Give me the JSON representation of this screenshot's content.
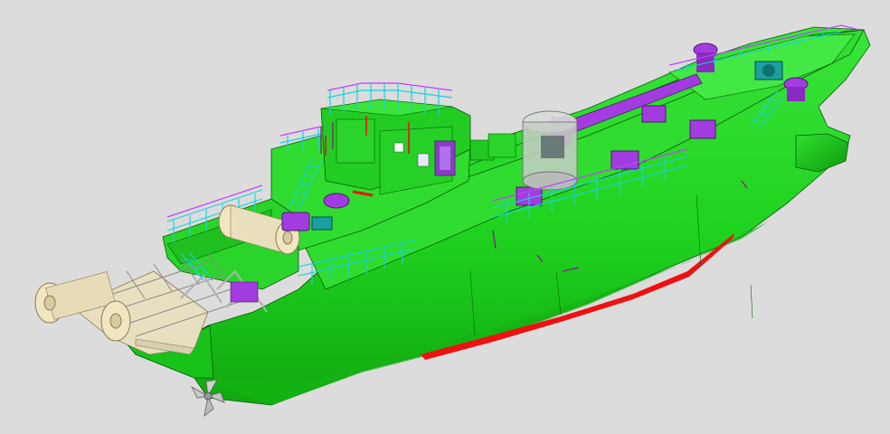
{
  "viewport": {
    "background": "#dcdcdc",
    "scene": "3d-ship-model"
  },
  "colors": {
    "hull": "#1fd21f",
    "hull_dark": "#12b012",
    "hull_light": "#3ae43a",
    "keel_stripe": "#ee1111",
    "equipment": "#a23ce0",
    "railing": "#18d2e0",
    "railing_top": "#c040ff",
    "winch_drum": "#f2e6c2",
    "glass": "#c8cdc8",
    "propeller": "#c8c8c8",
    "edge": "#0a5a0a"
  },
  "icons": {
    "propeller": "propeller-icon",
    "winch": "winch-drum-icon",
    "crane": "crane-icon"
  }
}
